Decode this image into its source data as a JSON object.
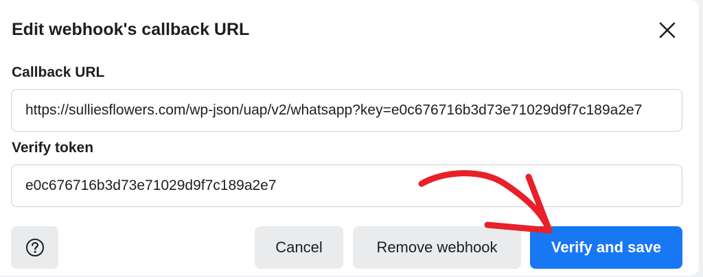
{
  "dialog": {
    "title": "Edit webhook's callback URL"
  },
  "fields": {
    "callback_url": {
      "label": "Callback URL",
      "value": "https://sulliesflowers.com/wp-json/uap/v2/whatsapp?key=e0c676716b3d73e71029d9f7c189a2e7"
    },
    "verify_token": {
      "label": "Verify token",
      "value": "e0c676716b3d73e71029d9f7c189a2e7"
    }
  },
  "footer": {
    "cancel_label": "Cancel",
    "remove_label": "Remove webhook",
    "verify_label": "Verify and save"
  },
  "icons": {
    "close": "close-icon",
    "help": "question-mark-icon"
  },
  "annotation": {
    "arrow_color": "#e8202a"
  },
  "colors": {
    "primary": "#1877f2",
    "secondary_button": "#eaebed",
    "text": "#1c1e21",
    "border": "#ced0d4"
  }
}
